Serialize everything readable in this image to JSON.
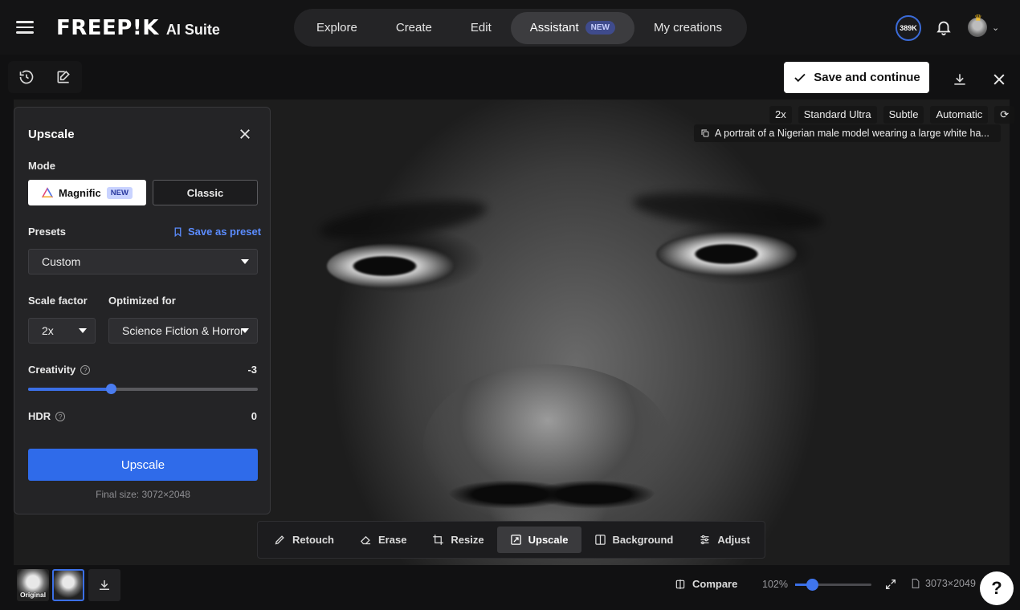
{
  "header": {
    "brand": "FREEP!K",
    "suite": "AI Suite",
    "nav": [
      {
        "label": "Explore"
      },
      {
        "label": "Create"
      },
      {
        "label": "Edit"
      },
      {
        "label": "Assistant",
        "badge": "NEW"
      },
      {
        "label": "My creations"
      }
    ],
    "credits": "389K"
  },
  "toolbar": {
    "save_label": "Save and continue"
  },
  "image_info": {
    "chips": [
      "2x",
      "Standard Ultra",
      "Subtle",
      "Automatic"
    ],
    "prompt": "A portrait of a Nigerian male model wearing a large white ha..."
  },
  "panel": {
    "title": "Upscale",
    "mode_label": "Mode",
    "mode_magnific": "Magnific",
    "mode_magnific_badge": "NEW",
    "mode_classic": "Classic",
    "presets_label": "Presets",
    "save_preset": "Save as preset",
    "preset_value": "Custom",
    "scale_label": "Scale factor",
    "scale_value": "2x",
    "optimized_label": "Optimized for",
    "optimized_value": "Science Fiction & Horror",
    "creativity_label": "Creativity",
    "creativity_value": "-3",
    "creativity_level": 0.36,
    "hdr_label": "HDR",
    "hdr_value": "0",
    "upscale_button": "Upscale",
    "final_size": "Final size: 3072×2048"
  },
  "tools": [
    {
      "label": "Retouch",
      "icon": "pencil-icon"
    },
    {
      "label": "Erase",
      "icon": "eraser-icon"
    },
    {
      "label": "Resize",
      "icon": "crop-icon"
    },
    {
      "label": "Upscale",
      "icon": "upscale-icon",
      "active": true
    },
    {
      "label": "Background",
      "icon": "background-icon"
    },
    {
      "label": "Adjust",
      "icon": "sliders-icon"
    }
  ],
  "footer": {
    "thumb_original": "Original",
    "compare_label": "Compare",
    "zoom": "102%",
    "zoom_level": 0.22,
    "dimensions": "3073×2049",
    "help": "?"
  },
  "colors": {
    "accent": "#2f6bea",
    "background": "#111112",
    "panel": "#242426"
  }
}
